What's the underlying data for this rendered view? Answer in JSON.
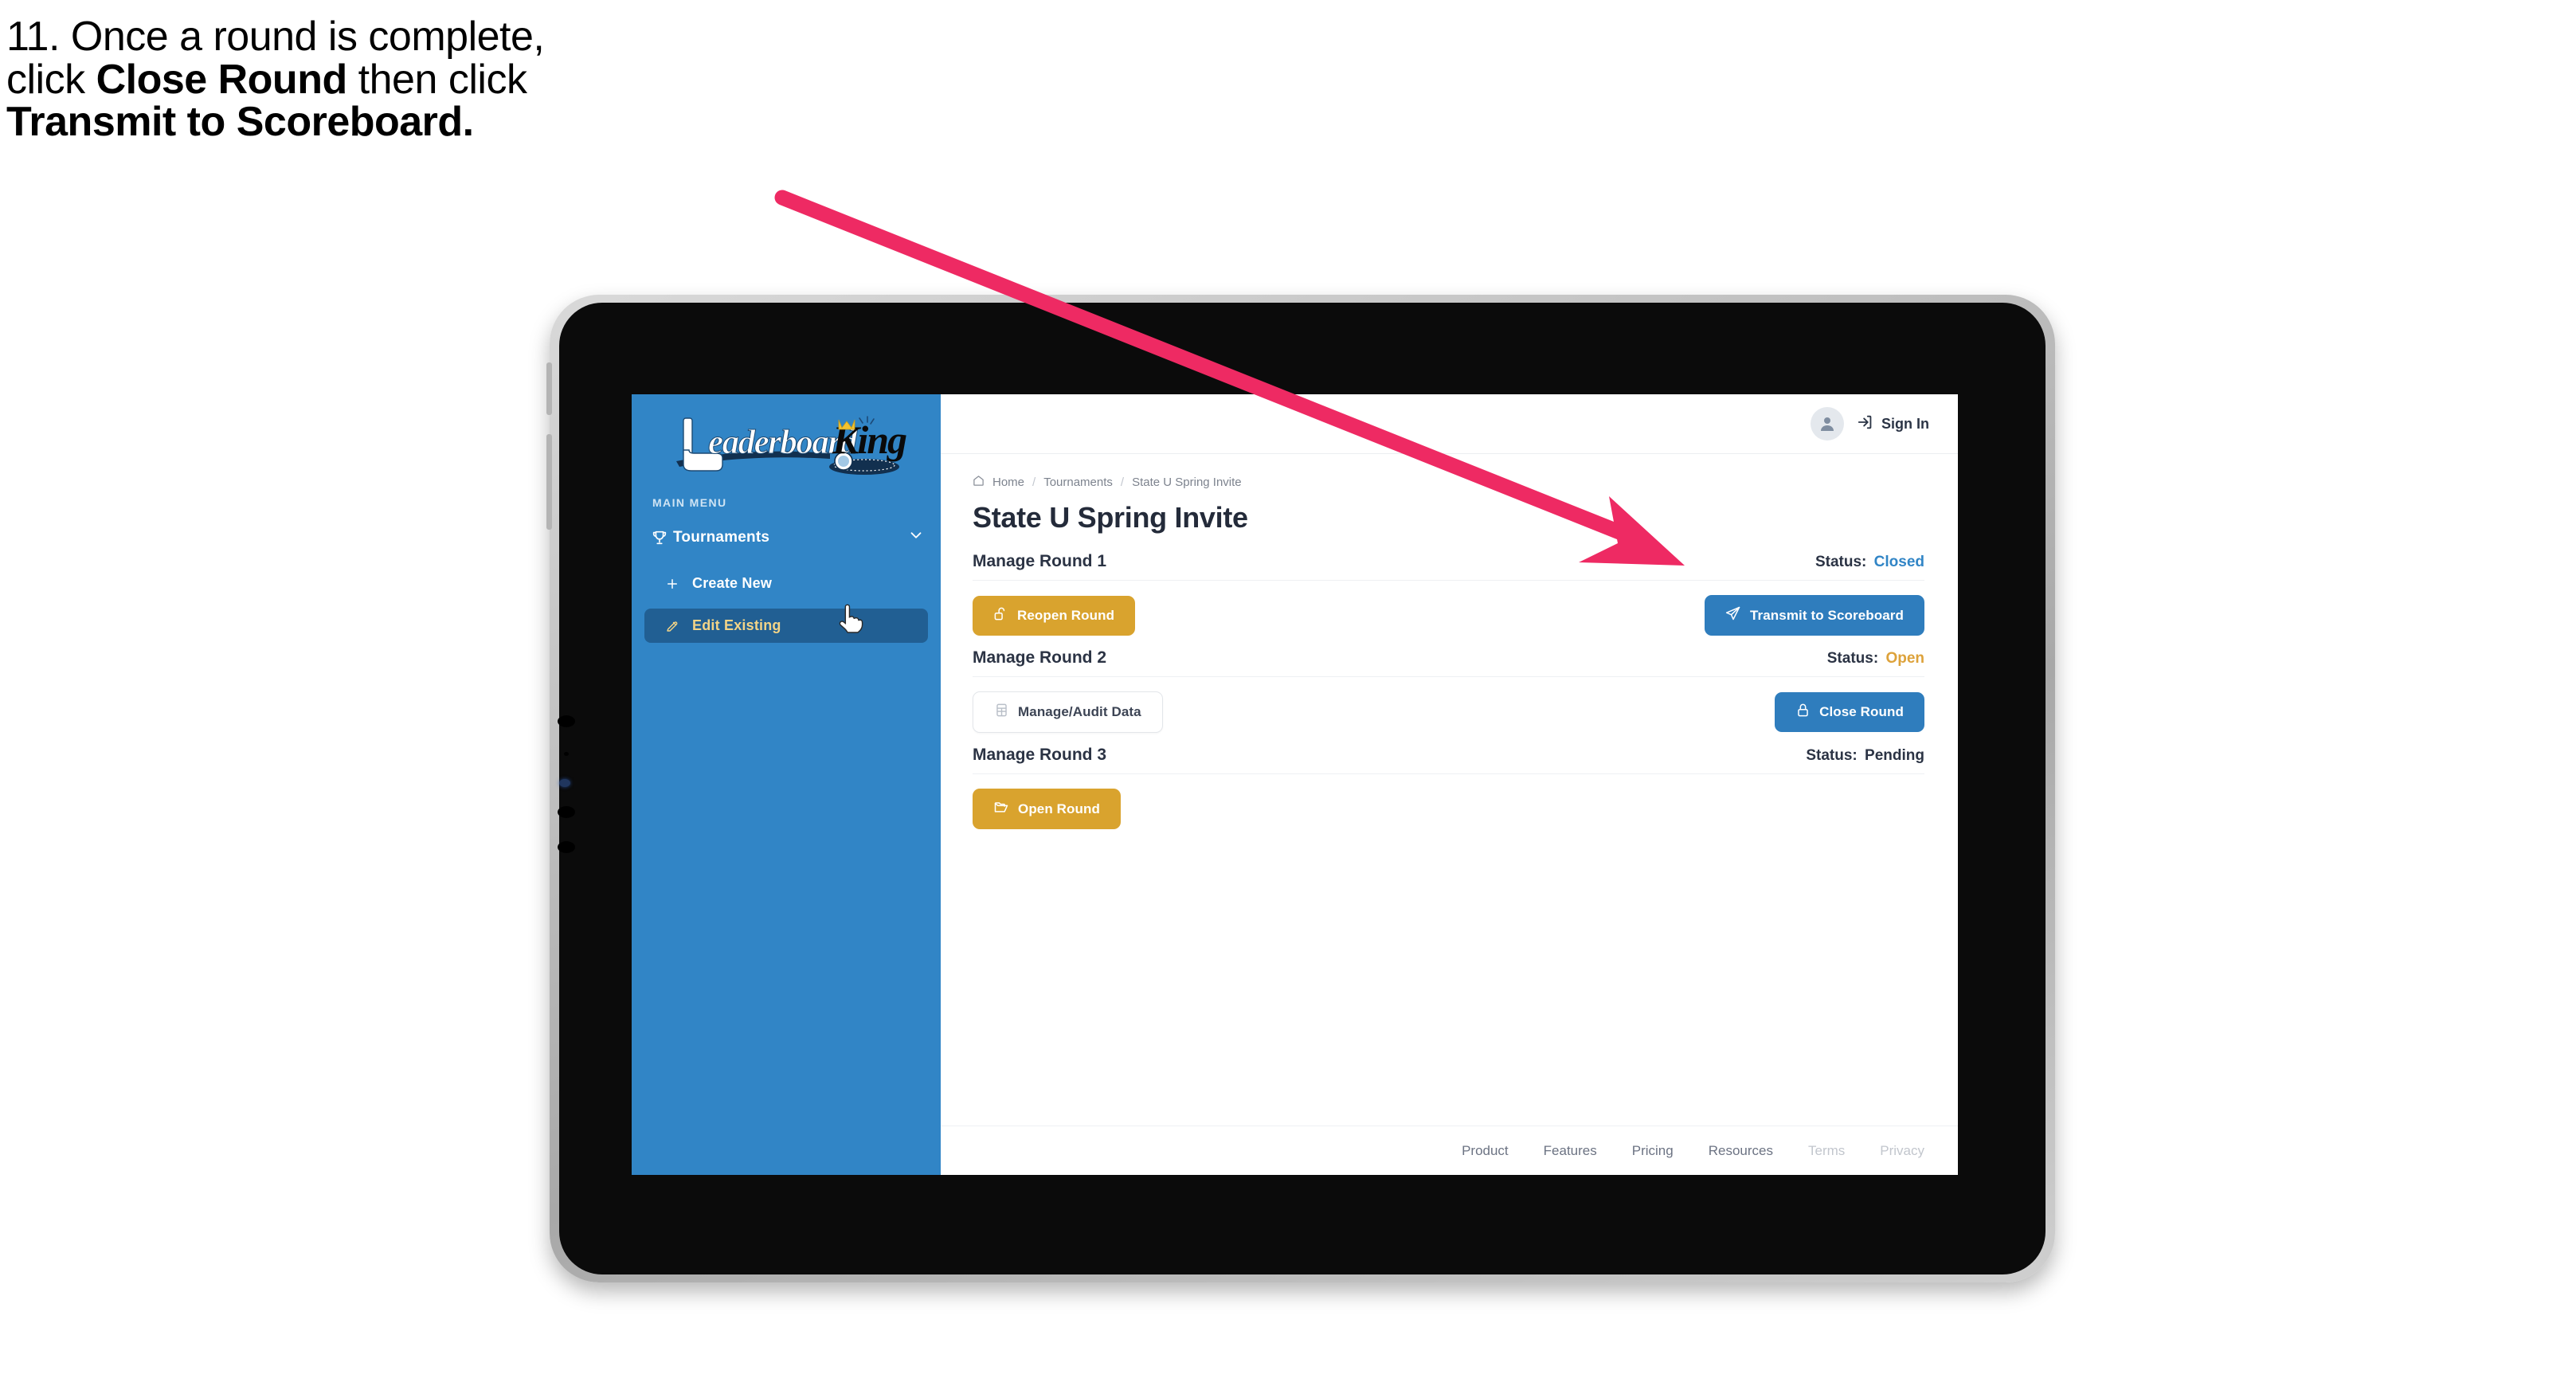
{
  "caption": {
    "line1": "11. Once a round is complete,",
    "line2_pre": "click ",
    "line2_bold": "Close Round",
    "line2_post": " then click",
    "line3_bold": "Transmit to Scoreboard."
  },
  "annotation": {
    "arrow_color": "#ee2a63",
    "points_to": "transmit-to-scoreboard-button"
  },
  "sidebar": {
    "logo": {
      "word1": "Leaderboard",
      "word2": "King",
      "icon": "golf-club-icon",
      "crown_icon": "crown-icon"
    },
    "menu_label": "MAIN MENU",
    "nav": {
      "label": "Tournaments",
      "icon": "trophy-icon",
      "chevron": "chevron-down-icon"
    },
    "items": [
      {
        "label": "Create New",
        "icon": "plus-icon",
        "active": false
      },
      {
        "label": "Edit Existing",
        "icon": "edit-pencil-icon",
        "active": true
      }
    ],
    "bg_color": "#3185c6",
    "active_bg_color": "#215f93",
    "active_text_color": "#f3d487"
  },
  "topbar": {
    "avatar_icon": "user-avatar-icon",
    "signin_icon": "login-arrow-icon",
    "signin_label": "Sign In"
  },
  "breadcrumb": {
    "home_icon": "home-icon",
    "items": [
      "Home",
      "Tournaments",
      "State U Spring Invite"
    ],
    "separator": "/"
  },
  "page_title": "State U Spring Invite",
  "rounds": [
    {
      "title": "Manage Round 1",
      "status_label": "Status:",
      "status_value": "Closed",
      "status_color": "#3185c6",
      "left_button": {
        "label": "Reopen Round",
        "icon": "unlock-icon",
        "style": "gold"
      },
      "right_button": {
        "label": "Transmit to Scoreboard",
        "icon": "paper-plane-icon",
        "style": "blue"
      }
    },
    {
      "title": "Manage Round 2",
      "status_label": "Status:",
      "status_value": "Open",
      "status_color": "#dda23a",
      "left_button": {
        "label": "Manage/Audit Data",
        "icon": "table-grid-icon",
        "style": "ghost"
      },
      "right_button": {
        "label": "Close Round",
        "icon": "lock-icon",
        "style": "blue"
      }
    },
    {
      "title": "Manage Round 3",
      "status_label": "Status:",
      "status_value": "Pending",
      "status_color": "#2b3344",
      "left_button": {
        "label": "Open Round",
        "icon": "open-folder-icon",
        "style": "gold"
      },
      "right_button": null
    }
  ],
  "footer": {
    "links": [
      "Product",
      "Features",
      "Pricing",
      "Resources",
      "Terms",
      "Privacy"
    ]
  },
  "cursor": {
    "icon": "pointing-hand-cursor"
  }
}
